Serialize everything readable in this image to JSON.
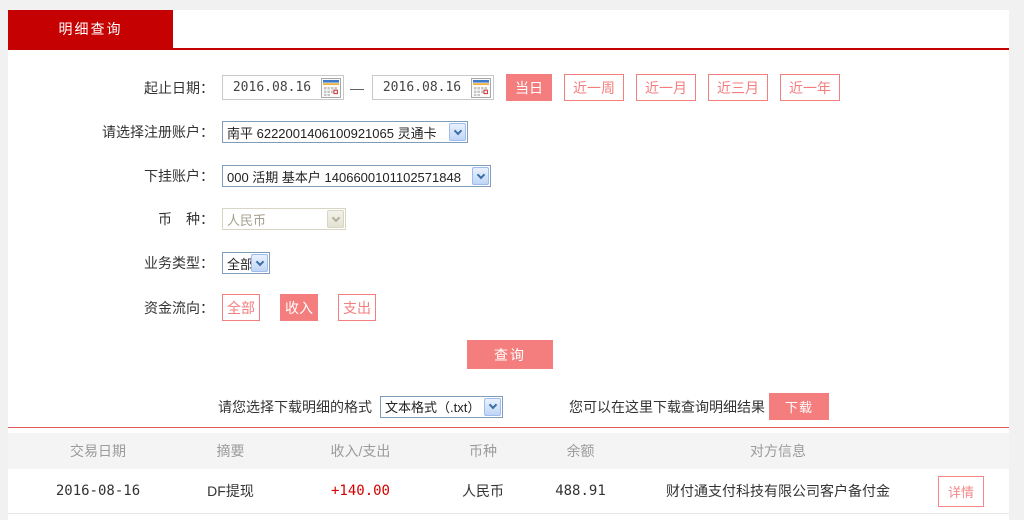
{
  "colors": {
    "brand_red": "#c50101",
    "accent_salmon": "#f47e7e",
    "amount_red": "#d40000"
  },
  "tab": {
    "label": "明细查询"
  },
  "form": {
    "date_row": {
      "label": "起止日期：",
      "start_date": "2016.08.16",
      "end_date": "2016.08.16",
      "separator": "—",
      "quick_buttons": [
        {
          "label": "当日",
          "active": true
        },
        {
          "label": "近一周",
          "active": false
        },
        {
          "label": "近一月",
          "active": false
        },
        {
          "label": "近三月",
          "active": false
        },
        {
          "label": "近一年",
          "active": false
        }
      ]
    },
    "register_account": {
      "label": "请选择注册账户：",
      "value": "南平 6222001406100921065 灵通卡"
    },
    "sub_account": {
      "label": "下挂账户：",
      "value": "000 活期 基本户 1406600101102571848"
    },
    "currency": {
      "label": "币　种：",
      "value": "人民币",
      "disabled": true
    },
    "business_type": {
      "label": "业务类型：",
      "value": "全部"
    },
    "fund_direction": {
      "label": "资金流向：",
      "buttons": [
        {
          "label": "全部",
          "active": false
        },
        {
          "label": "收入",
          "active": true
        },
        {
          "label": "支出",
          "active": false
        }
      ]
    },
    "query_button": "查询"
  },
  "download": {
    "format_label": "请您选择下载明细的格式",
    "format_value": "文本格式（.txt）",
    "hint": "您可以在这里下载查询明细结果",
    "button": "下载"
  },
  "table": {
    "headers": [
      "交易日期",
      "摘要",
      "收入/支出",
      "币种",
      "余额",
      "对方信息"
    ],
    "rows": [
      {
        "date": "2016-08-16",
        "summary": "DF提现",
        "amount": "+140.00",
        "currency": "人民币",
        "balance": "488.91",
        "counterparty": "财付通支付科技有限公司客户备付金",
        "detail_button": "详情"
      }
    ]
  }
}
